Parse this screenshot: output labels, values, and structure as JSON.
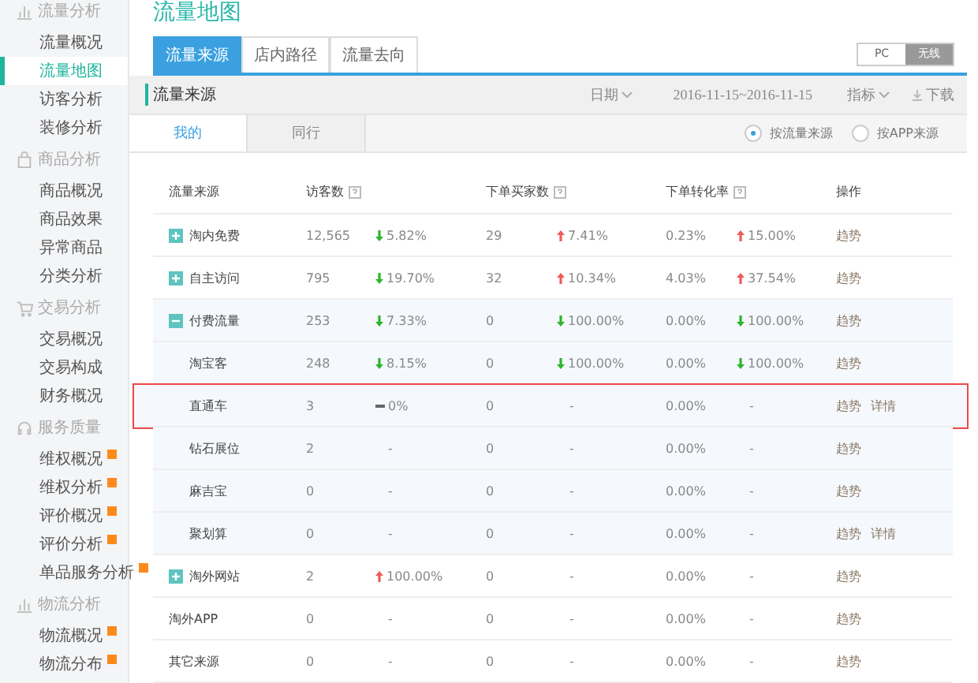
{
  "sidebar": {
    "groups": [
      {
        "title": "流量分析",
        "kind": "bars",
        "items": [
          {
            "label": "流量概况",
            "selected": false,
            "badge": false
          },
          {
            "label": "流量地图",
            "selected": true,
            "badge": false
          },
          {
            "label": "访客分析",
            "selected": false,
            "badge": false
          },
          {
            "label": "装修分析",
            "selected": false,
            "badge": false
          }
        ]
      },
      {
        "title": "商品分析",
        "kind": "bag",
        "items": [
          {
            "label": "商品概况",
            "selected": false,
            "badge": false
          },
          {
            "label": "商品效果",
            "selected": false,
            "badge": false
          },
          {
            "label": "异常商品",
            "selected": false,
            "badge": false
          },
          {
            "label": "分类分析",
            "selected": false,
            "badge": false
          }
        ]
      },
      {
        "title": "交易分析",
        "kind": "cart",
        "items": [
          {
            "label": "交易概况",
            "selected": false,
            "badge": false
          },
          {
            "label": "交易构成",
            "selected": false,
            "badge": false
          },
          {
            "label": "财务概况",
            "selected": false,
            "badge": false
          }
        ]
      },
      {
        "title": "服务质量",
        "kind": "headset",
        "items": [
          {
            "label": "维权概况",
            "selected": false,
            "badge": true
          },
          {
            "label": "维权分析",
            "selected": false,
            "badge": true
          },
          {
            "label": "评价概况",
            "selected": false,
            "badge": true
          },
          {
            "label": "评价分析",
            "selected": false,
            "badge": true
          },
          {
            "label": "单品服务分析",
            "selected": false,
            "badge": true
          }
        ]
      },
      {
        "title": "物流分析",
        "kind": "bars",
        "items": [
          {
            "label": "物流概况",
            "selected": false,
            "badge": true
          },
          {
            "label": "物流分布",
            "selected": false,
            "badge": true
          }
        ]
      }
    ]
  },
  "page_title": "流量地图",
  "tabs": [
    {
      "label": "流量来源",
      "selected": true
    },
    {
      "label": "店内路径",
      "selected": false
    },
    {
      "label": "流量去向",
      "selected": false
    }
  ],
  "device_toggle": [
    {
      "label": "PC",
      "selected": false
    },
    {
      "label": "无线",
      "selected": true
    }
  ],
  "panel": {
    "title": "流量来源",
    "date_menu": "日期",
    "date_range": "2016-11-15~2016-11-15",
    "metric_menu": "指标",
    "download": "下载"
  },
  "subtabs": [
    {
      "label": "我的",
      "selected": true
    },
    {
      "label": "同行",
      "selected": false
    }
  ],
  "radios": [
    {
      "label": "按流量来源",
      "selected": true
    },
    {
      "label": "按APP来源",
      "selected": false
    }
  ],
  "table": {
    "columns": [
      {
        "label": "流量来源",
        "help": false
      },
      {
        "label": "访客数",
        "help": true
      },
      {
        "label": "下单买家数",
        "help": true
      },
      {
        "label": "下单转化率",
        "help": true
      },
      {
        "label": "操作",
        "help": false
      }
    ],
    "rows": [
      {
        "kind": "parent",
        "expanded": false,
        "highlighted": false,
        "source": "淘内免费",
        "visitors": "12,565",
        "visitors_change": {
          "kind": "down",
          "text": "5.82%"
        },
        "buyers": "29",
        "buyers_change": {
          "kind": "up",
          "text": "7.41%"
        },
        "rate": "0.23%",
        "rate_change": {
          "kind": "up",
          "text": "15.00%"
        },
        "actions": [
          "趋势"
        ]
      },
      {
        "kind": "parent",
        "expanded": false,
        "highlighted": false,
        "source": "自主访问",
        "visitors": "795",
        "visitors_change": {
          "kind": "down",
          "text": "19.70%"
        },
        "buyers": "32",
        "buyers_change": {
          "kind": "up",
          "text": "10.34%"
        },
        "rate": "4.03%",
        "rate_change": {
          "kind": "up",
          "text": "37.54%"
        },
        "actions": [
          "趋势"
        ]
      },
      {
        "kind": "parent",
        "expanded": true,
        "highlighted": false,
        "source": "付费流量",
        "visitors": "253",
        "visitors_change": {
          "kind": "down",
          "text": "7.33%"
        },
        "buyers": "0",
        "buyers_change": {
          "kind": "down",
          "text": "100.00%"
        },
        "rate": "0.00%",
        "rate_change": {
          "kind": "down",
          "text": "100.00%"
        },
        "actions": [
          "趋势"
        ]
      },
      {
        "kind": "child",
        "highlighted": false,
        "source": "淘宝客",
        "visitors": "248",
        "visitors_change": {
          "kind": "down",
          "text": "8.15%"
        },
        "buyers": "0",
        "buyers_change": {
          "kind": "down",
          "text": "100.00%"
        },
        "rate": "0.00%",
        "rate_change": {
          "kind": "down",
          "text": "100.00%"
        },
        "actions": [
          "趋势"
        ]
      },
      {
        "kind": "child",
        "highlighted": true,
        "source": "直通车",
        "visitors": "3",
        "visitors_change": {
          "kind": "flat",
          "text": "0%"
        },
        "buyers": "0",
        "buyers_change": {
          "kind": "none",
          "text": "-"
        },
        "rate": "0.00%",
        "rate_change": {
          "kind": "none",
          "text": "-"
        },
        "actions": [
          "趋势",
          "详情"
        ]
      },
      {
        "kind": "child",
        "highlighted": false,
        "source": "钻石展位",
        "visitors": "2",
        "visitors_change": {
          "kind": "none",
          "text": "-"
        },
        "buyers": "0",
        "buyers_change": {
          "kind": "none",
          "text": "-"
        },
        "rate": "0.00%",
        "rate_change": {
          "kind": "none",
          "text": "-"
        },
        "actions": [
          "趋势"
        ]
      },
      {
        "kind": "child",
        "highlighted": false,
        "source": "麻吉宝",
        "visitors": "0",
        "visitors_change": {
          "kind": "none",
          "text": "-"
        },
        "buyers": "0",
        "buyers_change": {
          "kind": "none",
          "text": "-"
        },
        "rate": "0.00%",
        "rate_change": {
          "kind": "none",
          "text": "-"
        },
        "actions": [
          "趋势"
        ]
      },
      {
        "kind": "child",
        "highlighted": false,
        "source": "聚划算",
        "visitors": "0",
        "visitors_change": {
          "kind": "none",
          "text": "-"
        },
        "buyers": "0",
        "buyers_change": {
          "kind": "none",
          "text": "-"
        },
        "rate": "0.00%",
        "rate_change": {
          "kind": "none",
          "text": "-"
        },
        "actions": [
          "趋势",
          "详情"
        ]
      },
      {
        "kind": "parent",
        "expanded": false,
        "highlighted": false,
        "source": "淘外网站",
        "visitors": "2",
        "visitors_change": {
          "kind": "up",
          "text": "100.00%"
        },
        "buyers": "0",
        "buyers_change": {
          "kind": "none",
          "text": "-"
        },
        "rate": "0.00%",
        "rate_change": {
          "kind": "none",
          "text": "-"
        },
        "actions": [
          "趋势"
        ]
      },
      {
        "kind": "plain",
        "highlighted": false,
        "source": "淘外APP",
        "visitors": "0",
        "visitors_change": {
          "kind": "none",
          "text": "-"
        },
        "buyers": "0",
        "buyers_change": {
          "kind": "none",
          "text": "-"
        },
        "rate": "0.00%",
        "rate_change": {
          "kind": "none",
          "text": "-"
        },
        "actions": [
          "趋势"
        ]
      },
      {
        "kind": "plain",
        "highlighted": false,
        "source": "其它来源",
        "visitors": "0",
        "visitors_change": {
          "kind": "none",
          "text": "-"
        },
        "buyers": "0",
        "buyers_change": {
          "kind": "none",
          "text": "-"
        },
        "rate": "0.00%",
        "rate_change": {
          "kind": "none",
          "text": "-"
        },
        "actions": [
          "趋势"
        ]
      }
    ]
  }
}
